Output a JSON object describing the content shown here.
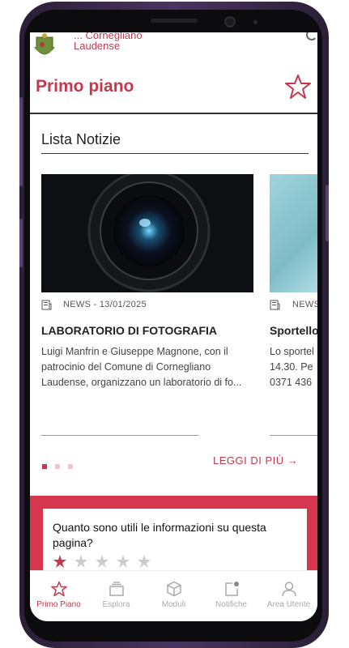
{
  "header": {
    "municipality_line1": "... Cornegliano",
    "municipality_line2": "Laudense",
    "page_title": "Primo piano"
  },
  "list": {
    "section_title": "Lista Notizie",
    "cards": [
      {
        "meta": "NEWS - 13/01/2025",
        "title": "LABORATORIO DI FOTOGRAFIA",
        "description": "Luigi Manfrin e Giuseppe Magnone, con il patrocinio del Comune di Cornegliano Laudense, organizzano un laboratorio di fo..."
      },
      {
        "meta": "NEWS",
        "title": "Sportello",
        "description": "Lo sportel 14.30. Pe 0371 436"
      }
    ],
    "read_more": "LEGGI DI PIÙ →",
    "pagination": {
      "count": 3,
      "active": 0
    }
  },
  "feedback": {
    "question": "Quanto sono utili le informazioni su questa pagina?",
    "rating": 1,
    "max": 5,
    "accent": "#d6374f"
  },
  "nav": {
    "items": [
      {
        "label": "Primo Piano",
        "icon": "star-icon",
        "active": true
      },
      {
        "label": "Esplora",
        "icon": "stack-icon",
        "active": false
      },
      {
        "label": "Moduli",
        "icon": "cube-icon",
        "active": false
      },
      {
        "label": "Notifiche",
        "icon": "notification-icon",
        "active": false
      },
      {
        "label": "Area Utente",
        "icon": "user-icon",
        "active": false
      }
    ]
  },
  "colors": {
    "brand": "#c33a4f",
    "text": "#222222"
  }
}
